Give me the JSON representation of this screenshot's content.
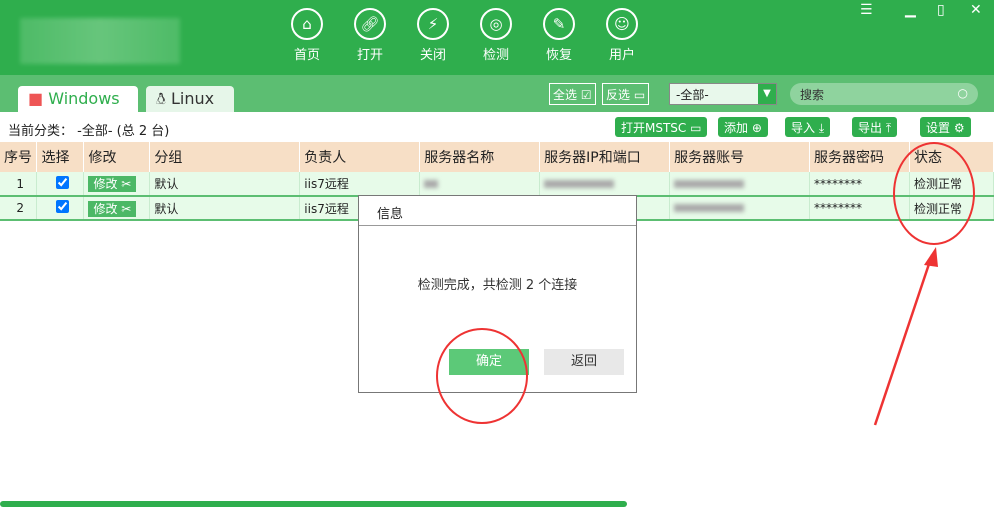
{
  "nav": [
    {
      "label": "首页",
      "icon": "home-icon"
    },
    {
      "label": "打开",
      "icon": "link-icon"
    },
    {
      "label": "关闭",
      "icon": "unlink-icon"
    },
    {
      "label": "检测",
      "icon": "radar-icon"
    },
    {
      "label": "恢复",
      "icon": "wrench-icon"
    },
    {
      "label": "用户",
      "icon": "user-icon"
    }
  ],
  "tabs": {
    "windows": "Windows",
    "linux": "Linux"
  },
  "toolbar": {
    "select_all": "全选",
    "invert": "反选",
    "category": "-全部-",
    "search_placeholder": "搜索"
  },
  "current": "当前分类： -全部- (总 2 台)",
  "buttons": {
    "mstsc": "打开MSTSC",
    "add": "添加",
    "import": "导入",
    "export": "导出",
    "settings": "设置"
  },
  "columns": [
    "序号",
    "选择",
    "修改",
    "分组",
    "负责人",
    "服务器名称",
    "服务器IP和端口",
    "服务器账号",
    "服务器密码",
    "状态"
  ],
  "rows": [
    {
      "no": "1",
      "edit": "修改",
      "group": "默认",
      "owner": "iis7远程",
      "name": "",
      "ip": "",
      "password": "********",
      "status": "检测正常"
    },
    {
      "no": "2",
      "edit": "修改",
      "group": "默认",
      "owner": "iis7远程",
      "name": "A5",
      "ip": "192.168.1.250",
      "password": "********",
      "status": "检测正常"
    }
  ],
  "dialog": {
    "title": "信息",
    "message": "检测完成，共检测 2 个连接",
    "ok": "确定",
    "back": "返回"
  },
  "colors": {
    "brand": "#2fae4d",
    "annotation": "#ee3333"
  }
}
